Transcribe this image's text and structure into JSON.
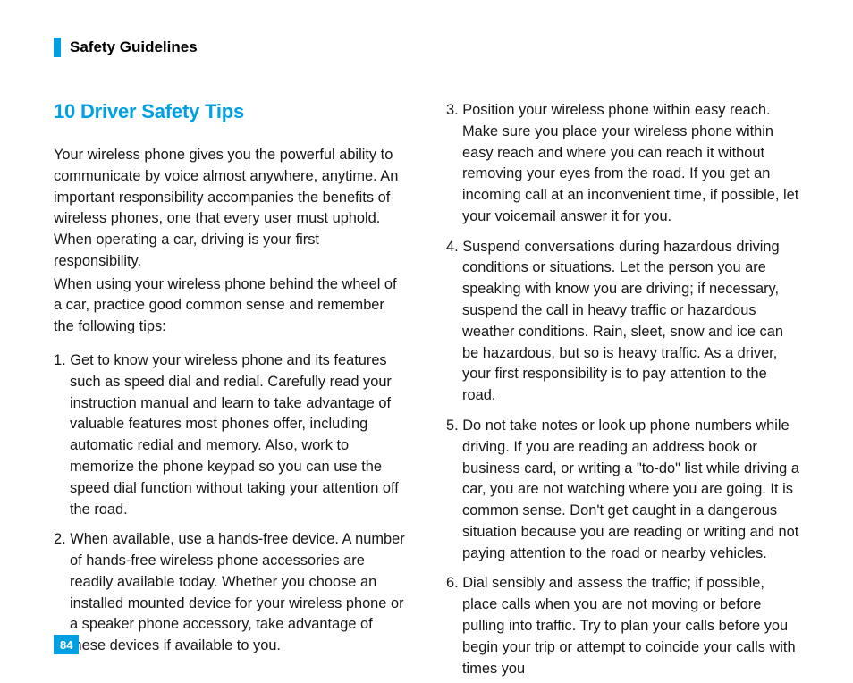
{
  "header": {
    "title": "Safety Guidelines"
  },
  "section": {
    "title": "10 Driver Safety Tips",
    "intro1": "Your wireless phone gives you the powerful ability to communicate by voice almost anywhere, anytime. An important responsibility accompanies the benefits of wireless phones, one that every user must uphold. When operating a car, driving is your first responsibility.",
    "intro2": "When using your wireless phone behind the wheel of a car, practice good common sense and remember the following tips:"
  },
  "tips": {
    "1": "1. Get to know your wireless phone and its features such as speed dial and redial. Carefully read your instruction manual and learn to take advantage of valuable features most phones offer, including automatic redial and memory. Also, work to memorize the phone keypad so you can use the speed dial function without taking your attention off the road.",
    "2": "2. When available, use a hands-free device. A number of hands-free wireless phone accessories are readily available today. Whether you choose an installed mounted device for your wireless phone or a speaker phone accessory, take advantage of these devices if available to you.",
    "3": "3. Position your wireless phone within easy reach. Make sure you place your wireless phone within easy reach and where you can reach it without removing your eyes from the road. If you get an incoming call at an inconvenient time, if possible, let your voicemail answer it for you.",
    "4": "4. Suspend conversations during hazardous driving conditions or situations. Let the person you are speaking with know you are driving; if necessary, suspend the call in heavy traffic or hazardous weather conditions. Rain, sleet, snow and ice can be hazardous, but so is heavy traffic. As a driver, your first responsibility is to pay attention to the road.",
    "5": "5. Do not take notes or look up phone numbers while driving. If you are reading an address book or business card, or writing a \"to-do\" list while driving a car, you are not watching where you are going. It is common sense. Don't get caught in a dangerous situation because you are reading or writing and not paying attention to the road or nearby vehicles.",
    "6": "6. Dial sensibly and assess the traffic; if possible, place calls when you are not moving or before pulling into traffic. Try to plan your calls before you begin your trip or attempt to coincide your calls with times you"
  },
  "page": {
    "number": "84"
  },
  "colors": {
    "accent": "#00a0e2"
  }
}
